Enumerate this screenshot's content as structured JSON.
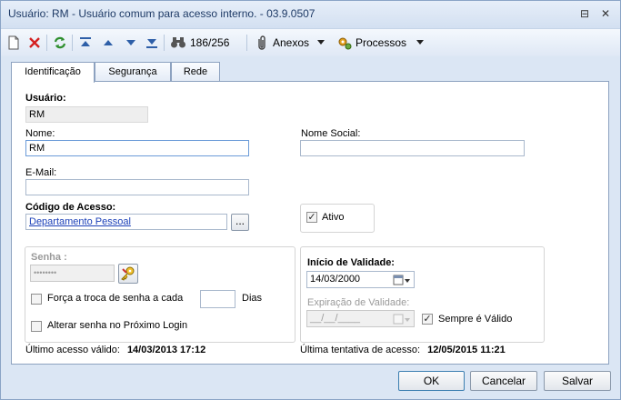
{
  "window": {
    "title": "Usuário: RM - Usuário comum para acesso interno. - 03.9.0507",
    "pin_glyph": "⊟",
    "close_glyph": "✕"
  },
  "toolbar": {
    "record_counter": "186/256",
    "attachments_label": "Anexos",
    "processes_label": "Processos",
    "icons": [
      "new-document-icon",
      "delete-icon",
      "refresh-icon",
      "first-record-icon",
      "previous-record-icon",
      "next-record-icon",
      "last-record-icon",
      "search-binoculars-icon",
      "attachment-icon",
      "processes-icon"
    ]
  },
  "tabs": [
    {
      "label": "Identificação",
      "active": true
    },
    {
      "label": "Segurança",
      "active": false
    },
    {
      "label": "Rede",
      "active": false
    }
  ],
  "form": {
    "usuario_label": "Usuário:",
    "usuario_value": "RM",
    "nome_label": "Nome:",
    "nome_value": "RM",
    "nome_social_label": "Nome Social:",
    "nome_social_value": "",
    "email_label": "E-Mail:",
    "email_value": "",
    "codigo_acesso_label": "Código de Acesso:",
    "codigo_acesso_value": "Departamento Pessoal",
    "lookup_button_label": "...",
    "ativo_label": "Ativo",
    "ativo_checked": true,
    "senha_label": "Senha :",
    "senha_value": "••••••••",
    "forca_troca_label": "Força a troca de senha a cada",
    "forca_troca_checked": false,
    "dias_value": "",
    "dias_label": "Dias",
    "alterar_senha_label": "Alterar senha no Próximo Login",
    "alterar_senha_checked": false,
    "inicio_validade_label": "Início de Validade:",
    "inicio_validade_value": "14/03/2000",
    "expiracao_label": "Expiração de Validade:",
    "expiracao_value": "__/__/____",
    "sempre_valido_label": "Sempre é Válido",
    "sempre_valido_checked": true
  },
  "status": {
    "ultimo_acesso_label": "Último acesso válido:",
    "ultimo_acesso_value": "14/03/2013 17:12",
    "ultima_tentativa_label": "Última tentativa de acesso:",
    "ultima_tentativa_value": "12/05/2015 11:21"
  },
  "buttons": {
    "ok": "OK",
    "cancel": "Cancelar",
    "save": "Salvar"
  },
  "colors": {
    "window_bg": "#dbe6f4",
    "accent_border": "#8da2c0",
    "link": "#1a3fb8"
  }
}
